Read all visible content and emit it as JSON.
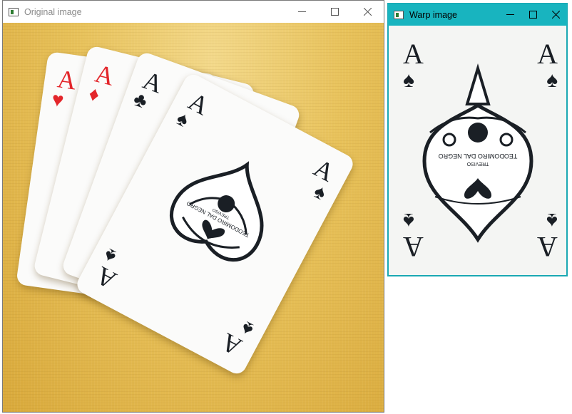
{
  "windows": {
    "original": {
      "title": "Original image"
    },
    "warp": {
      "title": "Warp image"
    }
  },
  "card": {
    "rank": "A",
    "maker_line1": "TEODOMIRO DAL NEGRO",
    "maker_line2": "TREVISO"
  },
  "icons": {
    "suits": [
      "heart-icon",
      "diamond-icon",
      "club-icon",
      "spade-icon"
    ]
  },
  "colors": {
    "warp_titlebar": "#18b4bf",
    "card_red": "#e3262b",
    "card_black": "#1a1f25",
    "table": "#e8c25b"
  }
}
